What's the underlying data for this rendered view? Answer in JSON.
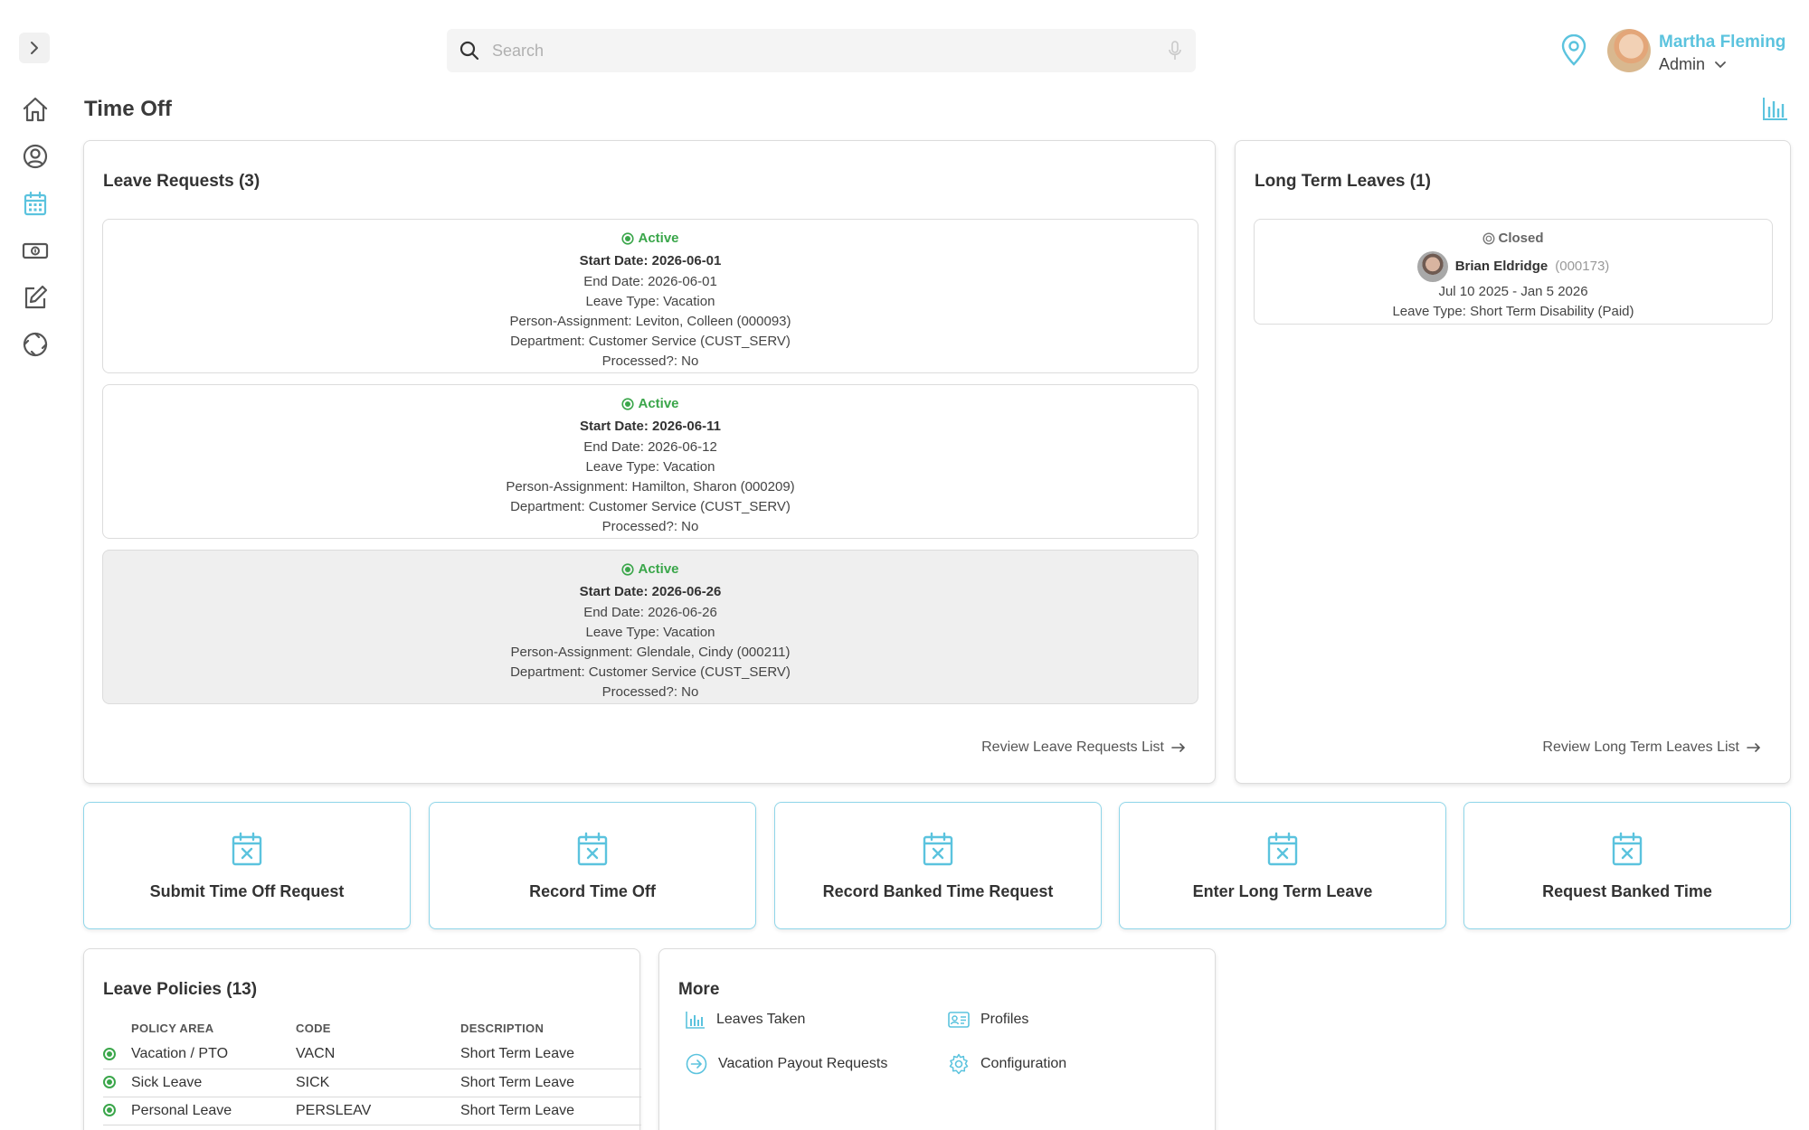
{
  "search": {
    "placeholder": "Search"
  },
  "user": {
    "name": "Martha Fleming",
    "role": "Admin"
  },
  "page_title": "Time Off",
  "leave_requests": {
    "title": "Leave Requests (3)",
    "items": [
      {
        "status": "Active",
        "start": "Start Date: 2026-06-01",
        "end": "End Date: 2026-06-01",
        "type": "Leave Type: Vacation",
        "person": "Person-Assignment: Leviton, Colleen (000093)",
        "dept": "Department: Customer Service (CUST_SERV)",
        "processed": "Processed?: No"
      },
      {
        "status": "Active",
        "start": "Start Date: 2026-06-11",
        "end": "End Date: 2026-06-12",
        "type": "Leave Type: Vacation",
        "person": "Person-Assignment: Hamilton, Sharon (000209)",
        "dept": "Department: Customer Service (CUST_SERV)",
        "processed": "Processed?: No"
      },
      {
        "status": "Active",
        "start": "Start Date: 2026-06-26",
        "end": "End Date: 2026-06-26",
        "type": "Leave Type: Vacation",
        "person": "Person-Assignment: Glendale, Cindy (000211)",
        "dept": "Department: Customer Service (CUST_SERV)",
        "processed": "Processed?: No"
      }
    ],
    "review_link": "Review Leave Requests List"
  },
  "long_term_leaves": {
    "title": "Long Term Leaves (1)",
    "items": [
      {
        "status": "Closed",
        "name": "Brian Eldridge",
        "id": "(000173)",
        "dates": "Jul 10 2025 - Jan 5 2026",
        "type": "Leave Type: Short Term Disability (Paid)"
      }
    ],
    "review_link": "Review Long Term Leaves List"
  },
  "actions": [
    "Submit Time Off Request",
    "Record Time Off",
    "Record Banked Time Request",
    "Enter Long Term Leave",
    "Request Banked Time"
  ],
  "leave_policies": {
    "title": "Leave Policies (13)",
    "headers": [
      "POLICY AREA",
      "CODE",
      "DESCRIPTION"
    ],
    "rows": [
      {
        "area": "Vacation / PTO",
        "code": "VACN",
        "description": "Short Term Leave"
      },
      {
        "area": "Sick Leave",
        "code": "SICK",
        "description": "Short Term Leave"
      },
      {
        "area": "Personal Leave",
        "code": "PERSLEAV",
        "description": "Short Term Leave"
      }
    ]
  },
  "more": {
    "title": "More",
    "links": [
      {
        "label": "Leaves Taken",
        "icon": "bar-chart-icon"
      },
      {
        "label": "Profiles",
        "icon": "id-card-icon"
      },
      {
        "label": "Vacation Payout Requests",
        "icon": "arrow-circle-icon"
      },
      {
        "label": "Configuration",
        "icon": "gear-icon"
      }
    ]
  },
  "colors": {
    "accent": "#5bc3de",
    "active": "#3aa64a",
    "border": "#dcdcdc"
  }
}
